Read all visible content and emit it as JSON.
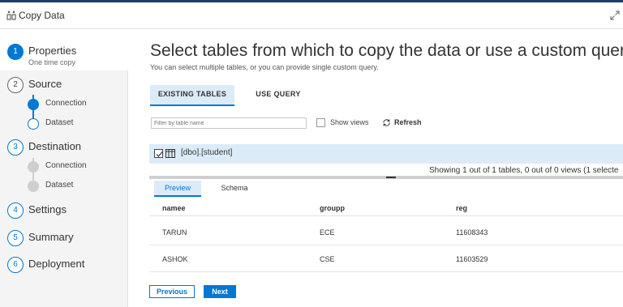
{
  "window": {
    "title": "Copy Data"
  },
  "sidebar": {
    "steps": [
      {
        "number": "1",
        "label": "Properties",
        "sub": "One time copy"
      },
      {
        "number": "2",
        "label": "Source"
      },
      {
        "number": "3",
        "label": "Destination"
      },
      {
        "number": "4",
        "label": "Settings"
      },
      {
        "number": "5",
        "label": "Summary"
      },
      {
        "number": "6",
        "label": "Deployment"
      }
    ],
    "source_substeps": [
      "Connection",
      "Dataset"
    ],
    "destination_substeps": [
      "Connection",
      "Dataset"
    ]
  },
  "main": {
    "heading": "Select tables from which to copy the data or use a custom query.",
    "subheading": "You can select multiple tables, or you can provide single custom query.",
    "tabs": [
      {
        "label": "EXISTING TABLES"
      },
      {
        "label": "USE QUERY"
      }
    ],
    "filter_placeholder": "Filter by table name",
    "show_views_label": "Show views",
    "refresh_label": "Refresh",
    "selected_table": "[dbo].[student]",
    "showing_text": "Showing 1 out of 1 tables, 0 out of 0 views (1 selecte",
    "preview_tabs": [
      {
        "label": "Preview"
      },
      {
        "label": "Schema"
      }
    ],
    "grid": {
      "columns": [
        "namee",
        "groupp",
        "reg"
      ],
      "rows": [
        [
          "TARUN",
          "ECE",
          "11608343"
        ],
        [
          "ASHOK",
          "CSE",
          "11603529"
        ],
        [
          "",
          "",
          ""
        ]
      ]
    },
    "buttons": {
      "previous": "Previous",
      "next": "Next"
    }
  },
  "colors": {
    "accent": "#0078d4",
    "active_tab_bg": "#dcebf8",
    "sidebar_bg": "#f4f4f4"
  }
}
